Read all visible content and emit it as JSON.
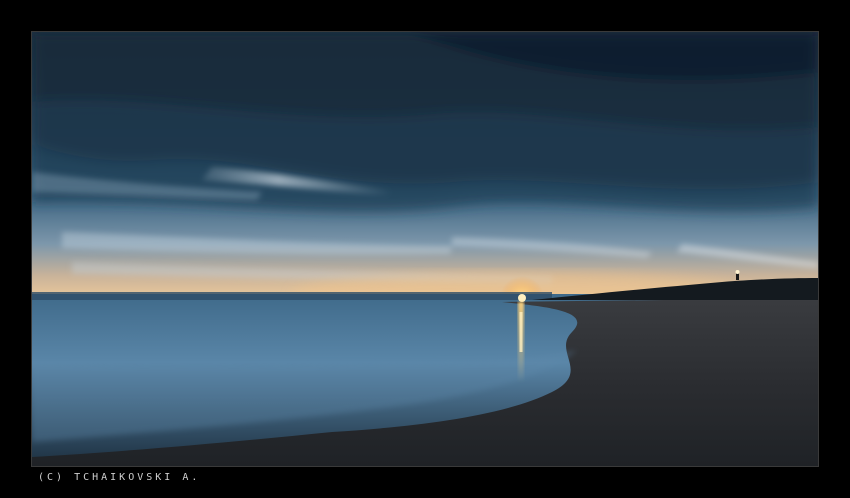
{
  "photo": {
    "subject": "dusk-seascape-beach",
    "icon": "landscape-photo-icon"
  },
  "credit": {
    "text": "(C) TCHAIKOVSKI A."
  },
  "colors": {
    "border": "#000000",
    "sky_dark": "#1b3244",
    "sky_mid": "#2f5772",
    "horizon_glow": "#f3c27a",
    "sun": "#ffd27a",
    "sea": "#3f6f93",
    "sand": "#2a2e33"
  }
}
